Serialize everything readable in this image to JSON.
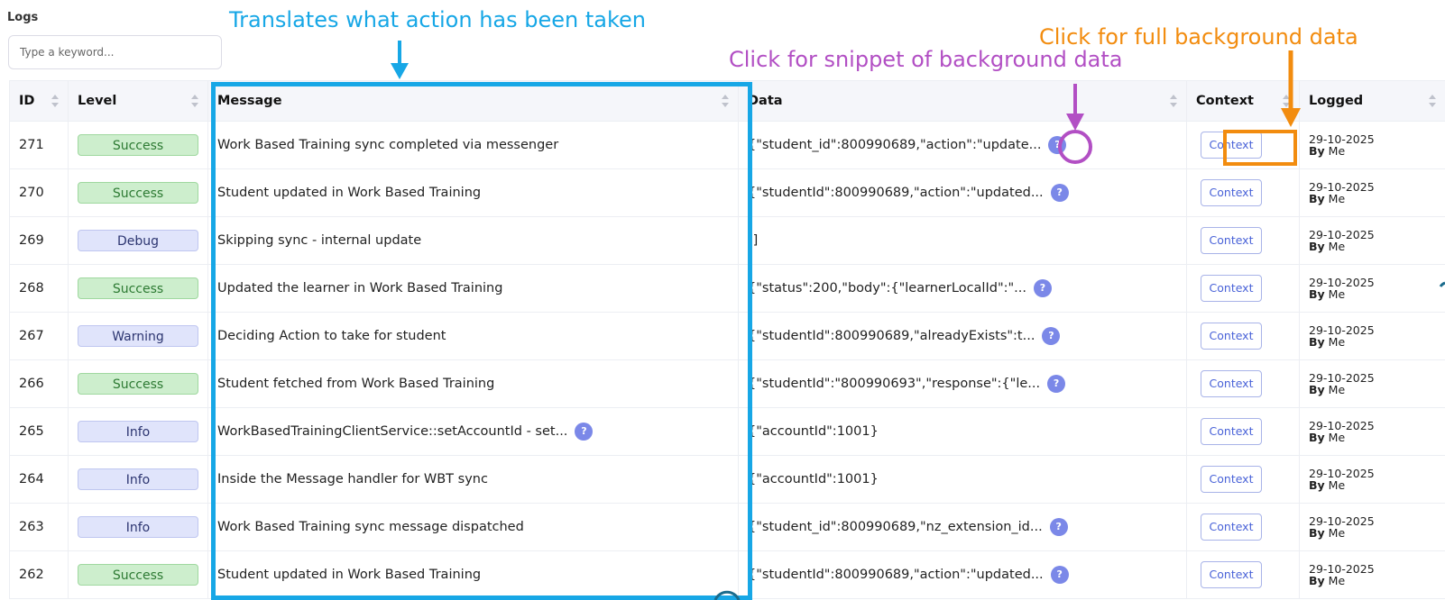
{
  "header": {
    "title": "Logs"
  },
  "search": {
    "placeholder": "Type a keyword..."
  },
  "columns": [
    "ID",
    "Level",
    "Message",
    "Data",
    "Context",
    "Logged"
  ],
  "rows": [
    {
      "id": "271",
      "level": "Success",
      "message": "Work Based Training sync completed via messenger",
      "data": "{\"student_id\":800990689,\"action\":\"update...",
      "context": "Context",
      "date": "29-10-2025",
      "by": "By",
      "user": "Me"
    },
    {
      "id": "270",
      "level": "Success",
      "message": "Student updated in Work Based Training",
      "data": "{\"studentId\":800990689,\"action\":\"updated...",
      "context": "Context",
      "date": "29-10-2025",
      "by": "By",
      "user": "Me"
    },
    {
      "id": "269",
      "level": "Debug",
      "message": "Skipping sync - internal update",
      "data": "[]",
      "context": "Context",
      "date": "29-10-2025",
      "by": "By",
      "user": "Me"
    },
    {
      "id": "268",
      "level": "Success",
      "message": "Updated the learner in Work Based Training",
      "data": "{\"status\":200,\"body\":{\"learnerLocalId\":\"...",
      "context": "Context",
      "date": "29-10-2025",
      "by": "By",
      "user": "Me"
    },
    {
      "id": "267",
      "level": "Warning",
      "message": "Deciding Action to take for student",
      "data": "{\"studentId\":800990689,\"alreadyExists\":t...",
      "context": "Context",
      "date": "29-10-2025",
      "by": "By",
      "user": "Me"
    },
    {
      "id": "266",
      "level": "Success",
      "message": "Student fetched from Work Based Training",
      "data": "{\"studentId\":\"800990693\",\"response\":{\"le...",
      "context": "Context",
      "date": "29-10-2025",
      "by": "By",
      "user": "Me"
    },
    {
      "id": "265",
      "level": "Info",
      "message": "WorkBasedTrainingClientService::setAccountId - set...",
      "data": "{\"accountId\":1001}",
      "context": "Context",
      "date": "29-10-2025",
      "by": "By",
      "user": "Me"
    },
    {
      "id": "264",
      "level": "Info",
      "message": "Inside the Message handler for WBT sync",
      "data": "{\"accountId\":1001}",
      "context": "Context",
      "date": "29-10-2025",
      "by": "By",
      "user": "Me"
    },
    {
      "id": "263",
      "level": "Info",
      "message": "Work Based Training sync message dispatched",
      "data": "{\"student_id\":800990689,\"nz_extension_id...",
      "context": "Context",
      "date": "29-10-2025",
      "by": "By",
      "user": "Me"
    },
    {
      "id": "262",
      "level": "Success",
      "message": "Student updated in Work Based Training",
      "data": "{\"studentId\":800990689,\"action\":\"updated...",
      "context": "Context",
      "date": "29-10-2025",
      "by": "By",
      "user": "Me"
    }
  ],
  "help_glyph": "?",
  "help_rows_message": [
    6
  ],
  "help_rows_data": [
    0,
    1,
    3,
    4,
    5,
    8,
    9
  ],
  "annotations": {
    "message": "Translates what action has been taken",
    "snippet": "Click for snippet of background data",
    "full": "Click for full background data"
  },
  "colors": {
    "blue": "#17a7e6",
    "purple": "#b24fc4",
    "orange": "#f28c0f",
    "success_bg": "#cdeecd",
    "neutral_bg": "#e0e4fb",
    "help": "#7b88e8",
    "context_text": "#4a63d8"
  }
}
